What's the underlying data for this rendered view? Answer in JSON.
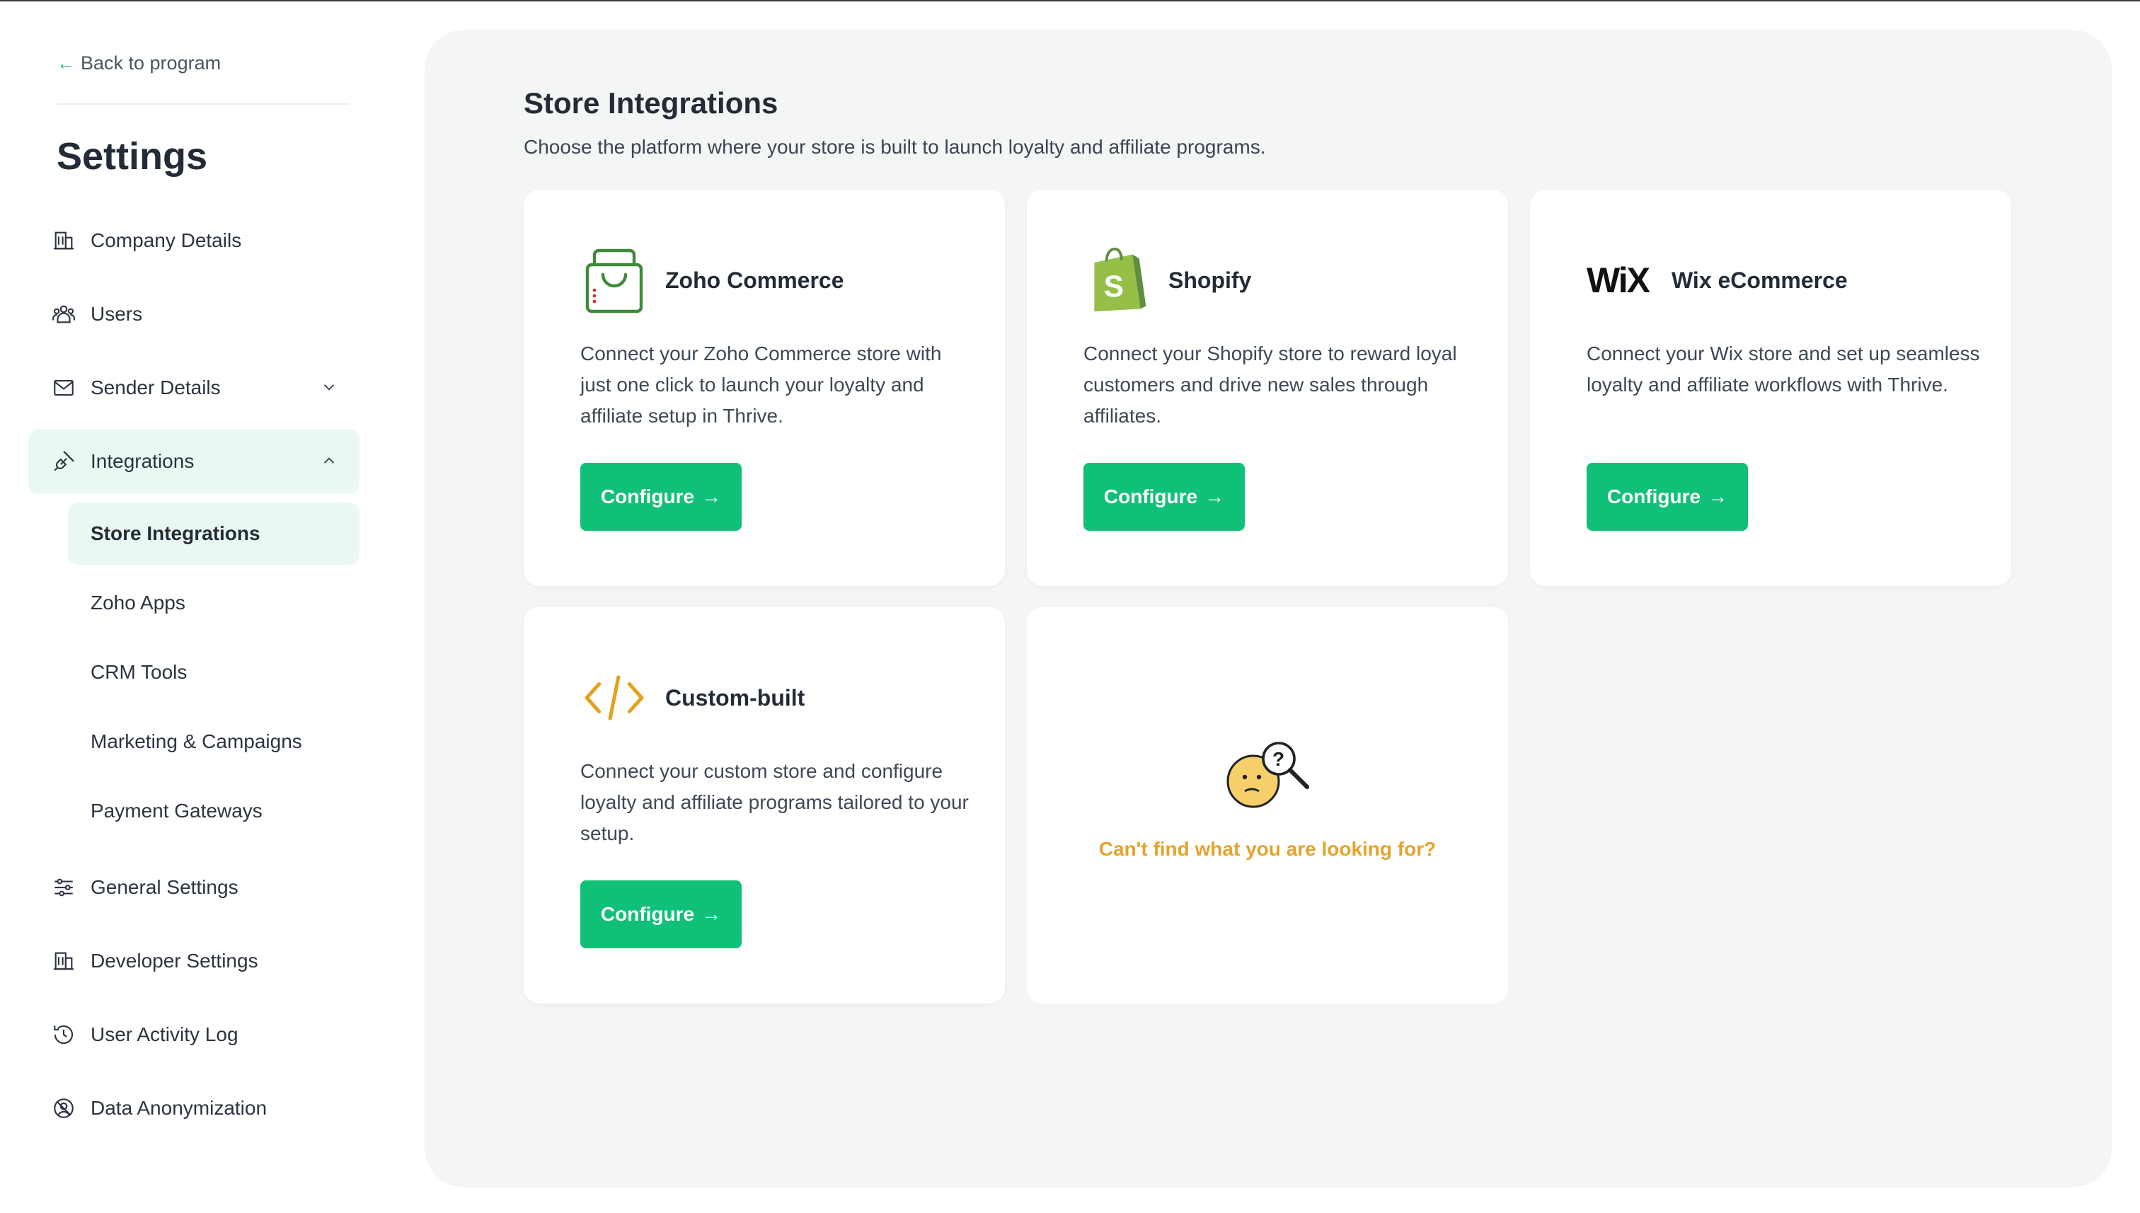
{
  "sidebar": {
    "back_label": "Back to program",
    "title": "Settings",
    "items": [
      {
        "label": "Company Details",
        "icon": "building-icon"
      },
      {
        "label": "Users",
        "icon": "users-icon"
      },
      {
        "label": "Sender Details",
        "icon": "mail-icon",
        "expandable": true
      },
      {
        "label": "Integrations",
        "icon": "plug-icon",
        "expanded": true,
        "active": true
      },
      {
        "label": "General Settings",
        "icon": "sliders-icon"
      },
      {
        "label": "Developer Settings",
        "icon": "building-icon"
      },
      {
        "label": "User Activity Log",
        "icon": "history-icon"
      },
      {
        "label": "Data Anonymization",
        "icon": "anonymize-icon"
      }
    ],
    "sub_items": [
      {
        "label": "Store Integrations",
        "active": true
      },
      {
        "label": "Zoho Apps"
      },
      {
        "label": "CRM Tools"
      },
      {
        "label": "Marketing & Campaigns"
      },
      {
        "label": "Payment Gateways"
      }
    ]
  },
  "main": {
    "title": "Store Integrations",
    "subtitle": "Choose the platform where your store is built to launch loyalty and affiliate programs.",
    "cards": [
      {
        "name": "Zoho Commerce",
        "description": "Connect your Zoho Commerce store with just one click to launch your loyalty and affiliate setup in Thrive.",
        "button": "Configure",
        "icon": "shopping-bag-icon"
      },
      {
        "name": "Shopify",
        "description": "Connect your Shopify store to reward loyal customers and drive new sales through affiliates.",
        "button": "Configure",
        "icon": "shopify-logo-icon"
      },
      {
        "name": "Wix eCommerce",
        "description": "Connect your Wix store and set up seamless loyalty and affiliate workflows with Thrive.",
        "button": "Configure",
        "icon": "wix-logo-icon",
        "logo_text": "WiX"
      },
      {
        "name": "Custom-built",
        "description": "Connect your custom store and configure loyalty and affiliate programs tailored to your setup.",
        "button": "Configure",
        "icon": "code-icon"
      }
    ],
    "help_text": "Can't find what you are looking for?"
  },
  "colors": {
    "accent": "#11c078",
    "active_bg": "#ebf8f1",
    "panel_bg": "#f4f5f5",
    "help_text": "#e6a32a"
  }
}
